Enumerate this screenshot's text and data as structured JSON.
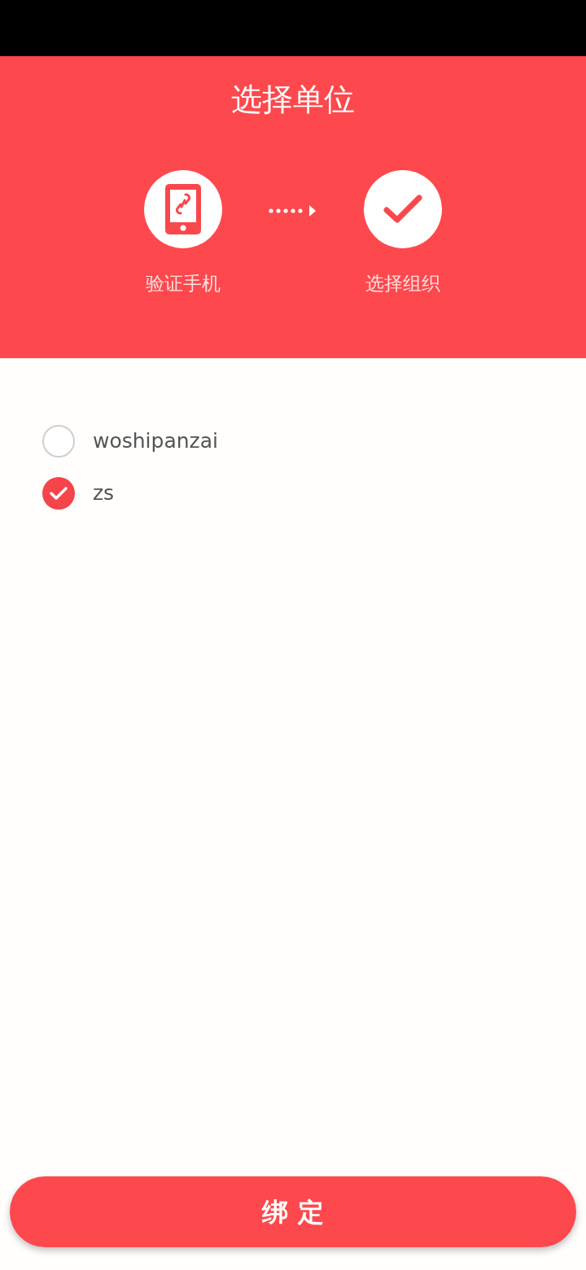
{
  "header": {
    "title": "选择单位"
  },
  "steps": [
    {
      "kind": "phone",
      "label": "验证手机"
    },
    {
      "kind": "check",
      "label": "选择组织"
    }
  ],
  "options": [
    {
      "label": "woshipanzai",
      "selected": false
    },
    {
      "label": "zs",
      "selected": true
    }
  ],
  "button": {
    "label": "绑 定"
  }
}
